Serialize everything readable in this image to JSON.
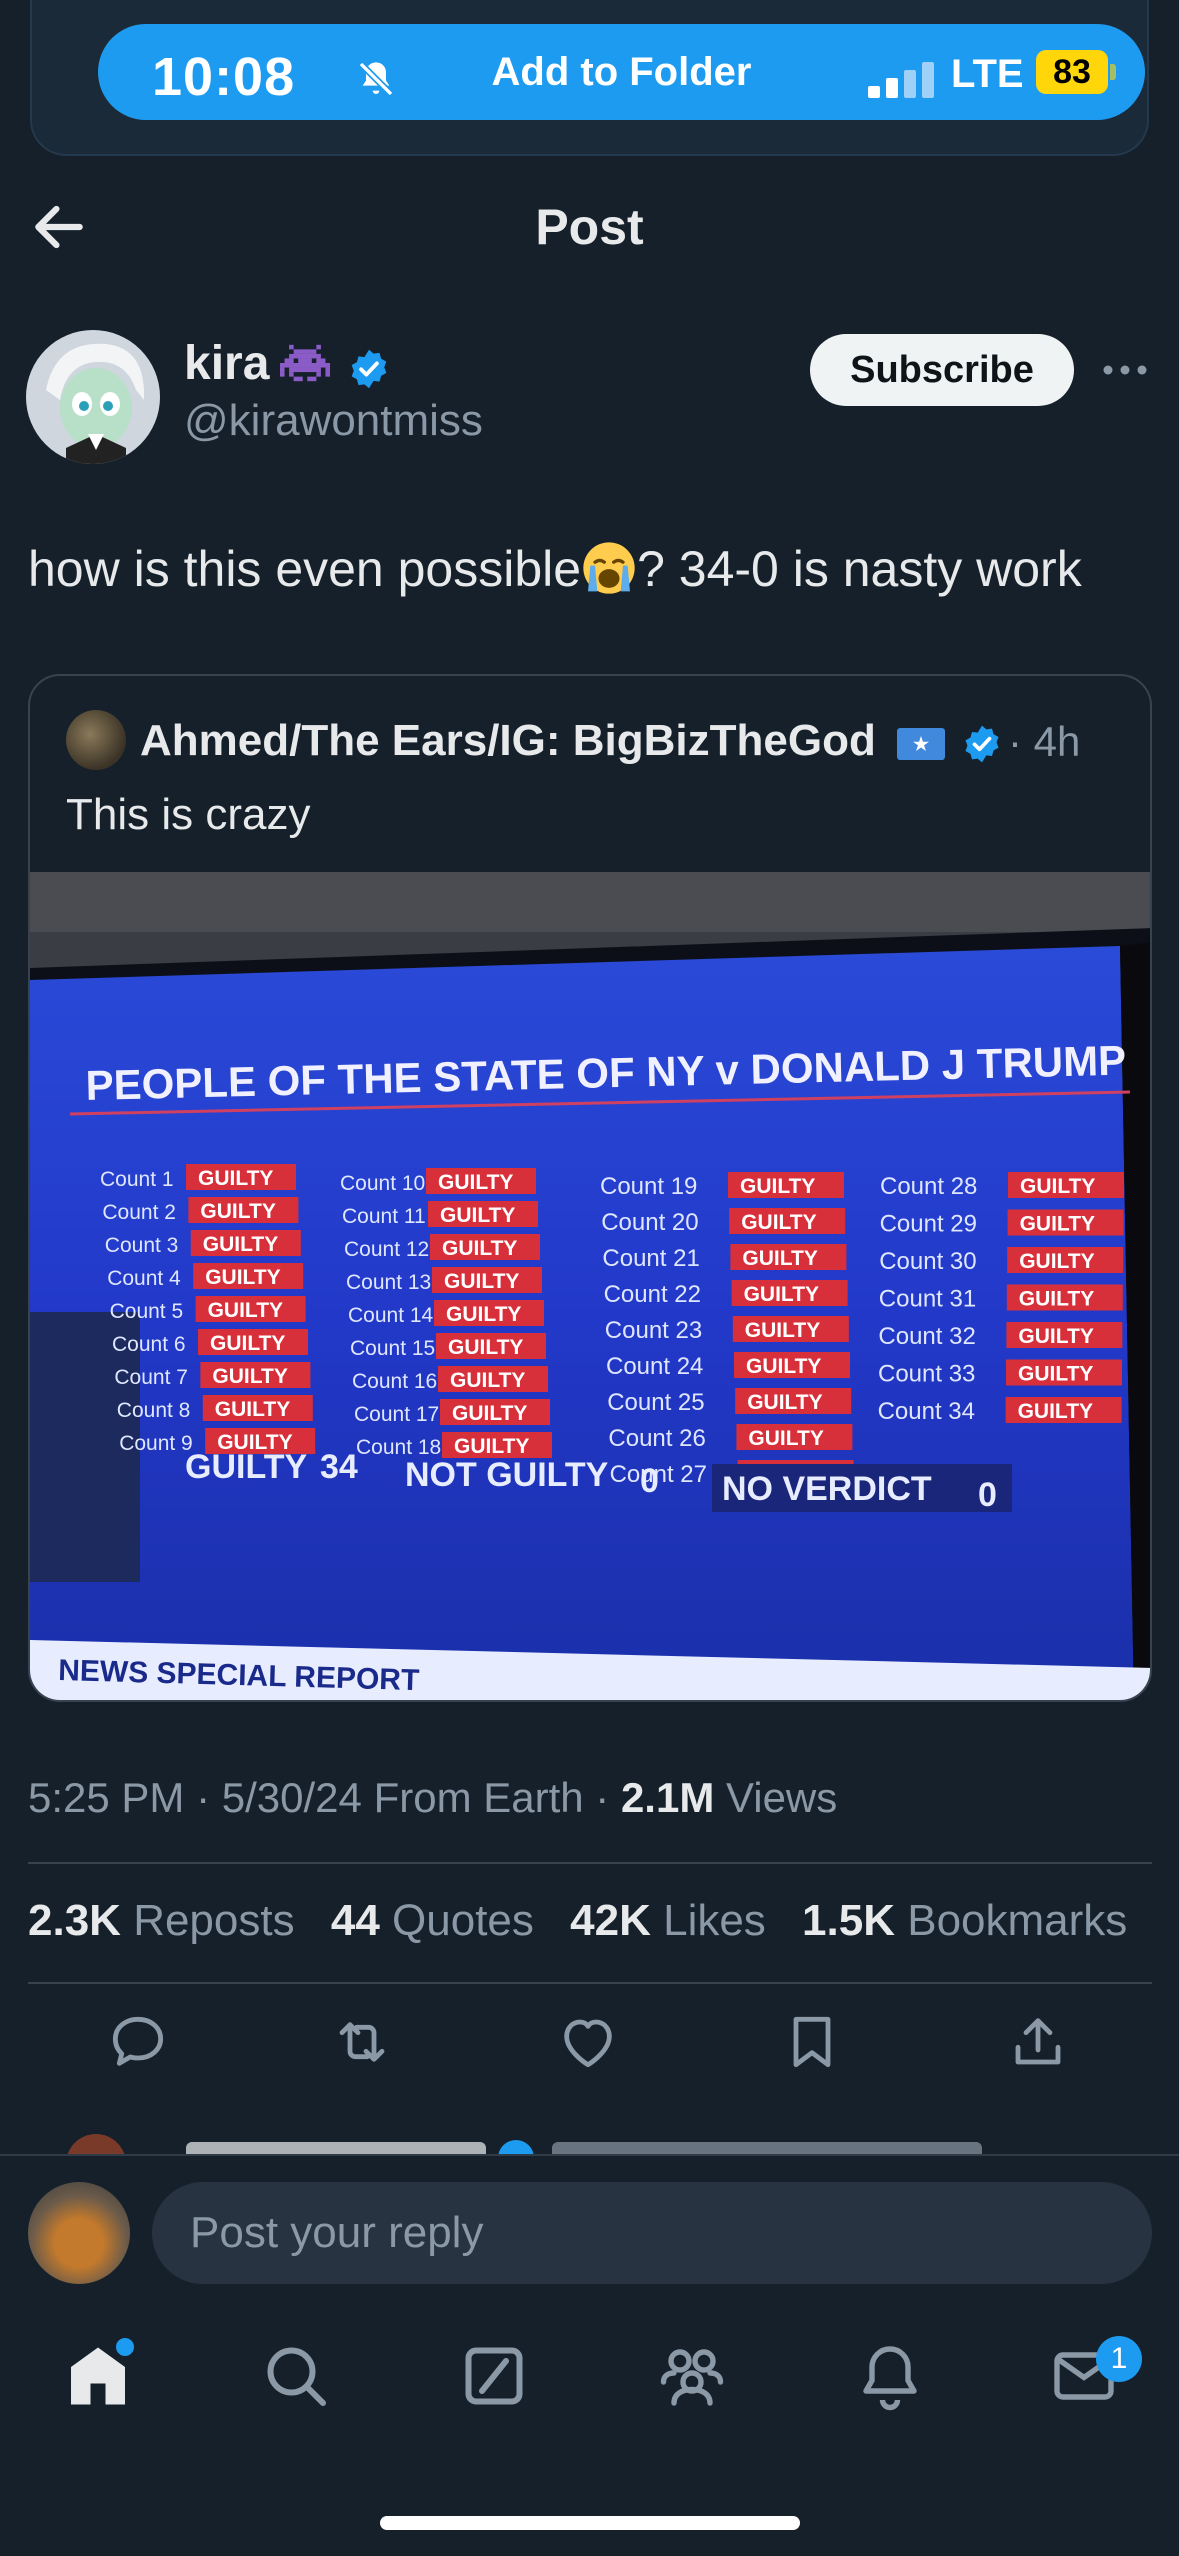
{
  "status": {
    "time": "10:08",
    "title": "Add to Folder",
    "network": "LTE",
    "battery": "83"
  },
  "header": {
    "title": "Post"
  },
  "author": {
    "name": "kira",
    "handle": "@kirawontmiss",
    "subscribe_label": "Subscribe"
  },
  "post": {
    "text": "how is this even possible",
    "text_after_emoji": "? 34-0 is nasty work"
  },
  "quote": {
    "name": "Ahmed/The Ears/IG: BigBizTheGod",
    "time": "· 4h",
    "text": "This is crazy",
    "image": {
      "headline": "PEOPLE OF THE STATE OF NY v DONALD J TRUMP",
      "count_label": "Count",
      "verdict_label": "GUILTY",
      "counts": [
        1,
        2,
        3,
        4,
        5,
        6,
        7,
        8,
        9,
        10,
        11,
        12,
        13,
        14,
        15,
        16,
        17,
        18,
        19,
        20,
        21,
        22,
        23,
        24,
        25,
        26,
        27,
        28,
        29,
        30,
        31,
        32,
        33,
        34
      ],
      "tally": [
        {
          "label": "GUILTY",
          "value": "34"
        },
        {
          "label": "NOT GUILTY",
          "value": "0"
        },
        {
          "label": "NO VERDICT",
          "value": "0"
        }
      ],
      "banner": "NEWS SPECIAL REPORT"
    }
  },
  "meta": {
    "time": "5:25 PM",
    "date": "5/30/24",
    "source": "From Earth",
    "views_value": "2.1M",
    "views_label": "Views"
  },
  "stats": {
    "reposts": {
      "value": "2.3K",
      "label": "Reposts"
    },
    "quotes": {
      "value": "44",
      "label": "Quotes"
    },
    "likes": {
      "value": "42K",
      "label": "Likes"
    },
    "bookmarks": {
      "value": "1.5K",
      "label": "Bookmarks"
    }
  },
  "reply": {
    "placeholder": "Post your reply"
  },
  "tabs": {
    "messages_badge": "1"
  },
  "colors": {
    "background": "#15202b",
    "accent": "#1d9bf0",
    "border": "#38444d",
    "muted": "#8b98a5"
  }
}
